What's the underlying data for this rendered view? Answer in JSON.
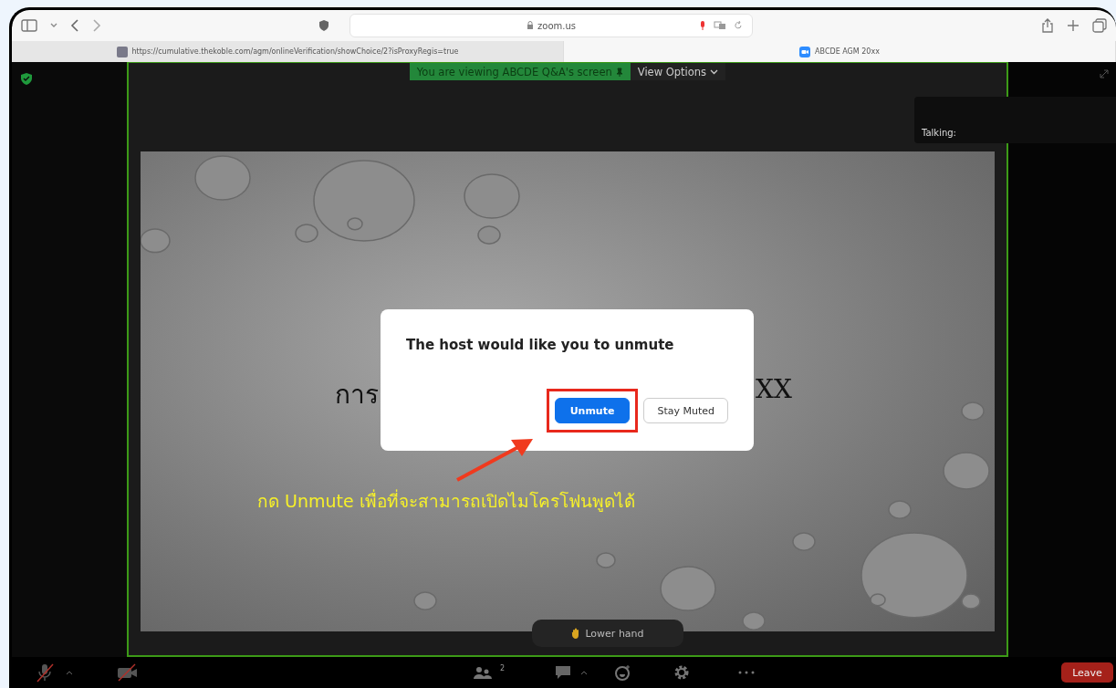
{
  "browser": {
    "address": "zoom.us",
    "tabs": [
      {
        "label": "https://cumulative.thekoble.com/agm/onlineVerification/showChoice/2?isProxyRegis=true",
        "selected": false
      },
      {
        "label": "ABCDE AGM 20xx",
        "selected": true
      }
    ]
  },
  "meeting": {
    "share_banner": "You are viewing ABCDE Q&A's screen",
    "view_options": "View Options",
    "talking": "Talking:",
    "slide": {
      "title_left": "การ",
      "title_right": "XX"
    },
    "dialog": {
      "message": "The host would like you to unmute",
      "buttons": [
        {
          "label": "Unmute",
          "kind": "primary"
        },
        {
          "label": "Stay Muted",
          "kind": "secondary"
        }
      ]
    },
    "annotation": "กด Unmute เพื่อที่จะสามารถเปิดไมโครโฟนพูดได้",
    "lower_hand": "Lower hand"
  },
  "toolbar": {
    "mic_muted": true,
    "video_off": true,
    "participants_count": "2",
    "leave": "Leave"
  }
}
